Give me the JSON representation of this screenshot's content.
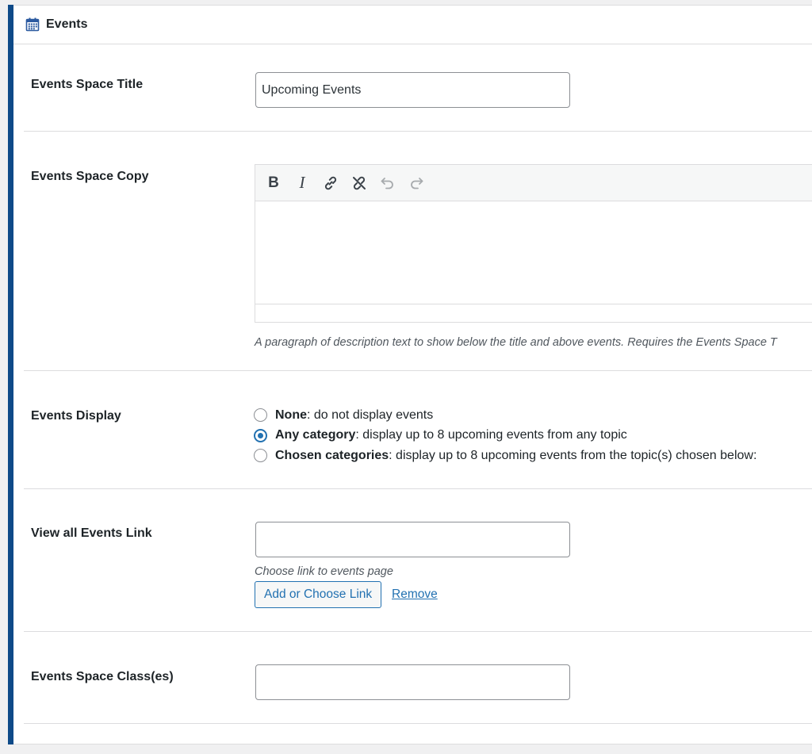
{
  "panel": {
    "title": "Events",
    "icon": "calendar-icon"
  },
  "fields": {
    "space_title": {
      "label": "Events Space Title",
      "value": "Upcoming Events"
    },
    "space_copy": {
      "label": "Events Space Copy",
      "toolbar": [
        "bold-icon",
        "italic-icon",
        "link-icon",
        "unlink-icon",
        "undo-icon",
        "redo-icon"
      ],
      "toolbar_bold": "B",
      "toolbar_italic": "I",
      "content": "",
      "help": "A paragraph of description text to show below the title and above events. Requires the Events Space T"
    },
    "display": {
      "label": "Events Display",
      "options": [
        {
          "strong": "None",
          "text": ": do not display events",
          "checked": false
        },
        {
          "strong": "Any category",
          "text": ": display up to 8 upcoming events from any topic",
          "checked": true
        },
        {
          "strong": "Chosen categories",
          "text": ": display up to 8 upcoming events from the topic(s) chosen below:",
          "checked": false
        }
      ]
    },
    "view_all_link": {
      "label": "View all Events Link",
      "value": "",
      "help": "Choose link to events page",
      "add_button": "Add or Choose Link",
      "remove_link": "Remove"
    },
    "space_classes": {
      "label": "Events Space Class(es)",
      "value": ""
    }
  },
  "colors": {
    "accent_bar": "#0e4a88",
    "link": "#2271b1",
    "border": "#dcdcde"
  }
}
